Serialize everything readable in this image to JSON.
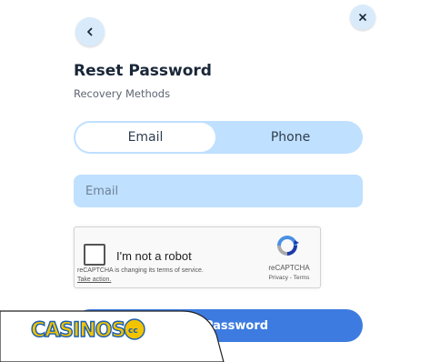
{
  "header": {
    "back_icon": "chevron-left-icon",
    "close_icon": "close-icon",
    "title": "Reset Password",
    "subtitle": "Recovery Methods"
  },
  "method_toggle": {
    "tabs": [
      {
        "label": "Email",
        "selected": true
      },
      {
        "label": "Phone",
        "selected": false
      }
    ]
  },
  "email_field": {
    "placeholder": "Email",
    "value": ""
  },
  "recaptcha": {
    "label": "I'm not a robot",
    "notice": "reCAPTCHA is changing its terms of service.",
    "action": "Take action.",
    "brand": "reCAPTCHA",
    "links": "Privacy - Terms",
    "checked": false
  },
  "submit": {
    "label": "Password"
  },
  "watermark": {
    "text": "CASINOS.cc"
  },
  "colors": {
    "accent": "#3d7be0",
    "field_bg": "#bfe0ff",
    "button_light": "#d9ebfb",
    "title": "#1a2738"
  }
}
